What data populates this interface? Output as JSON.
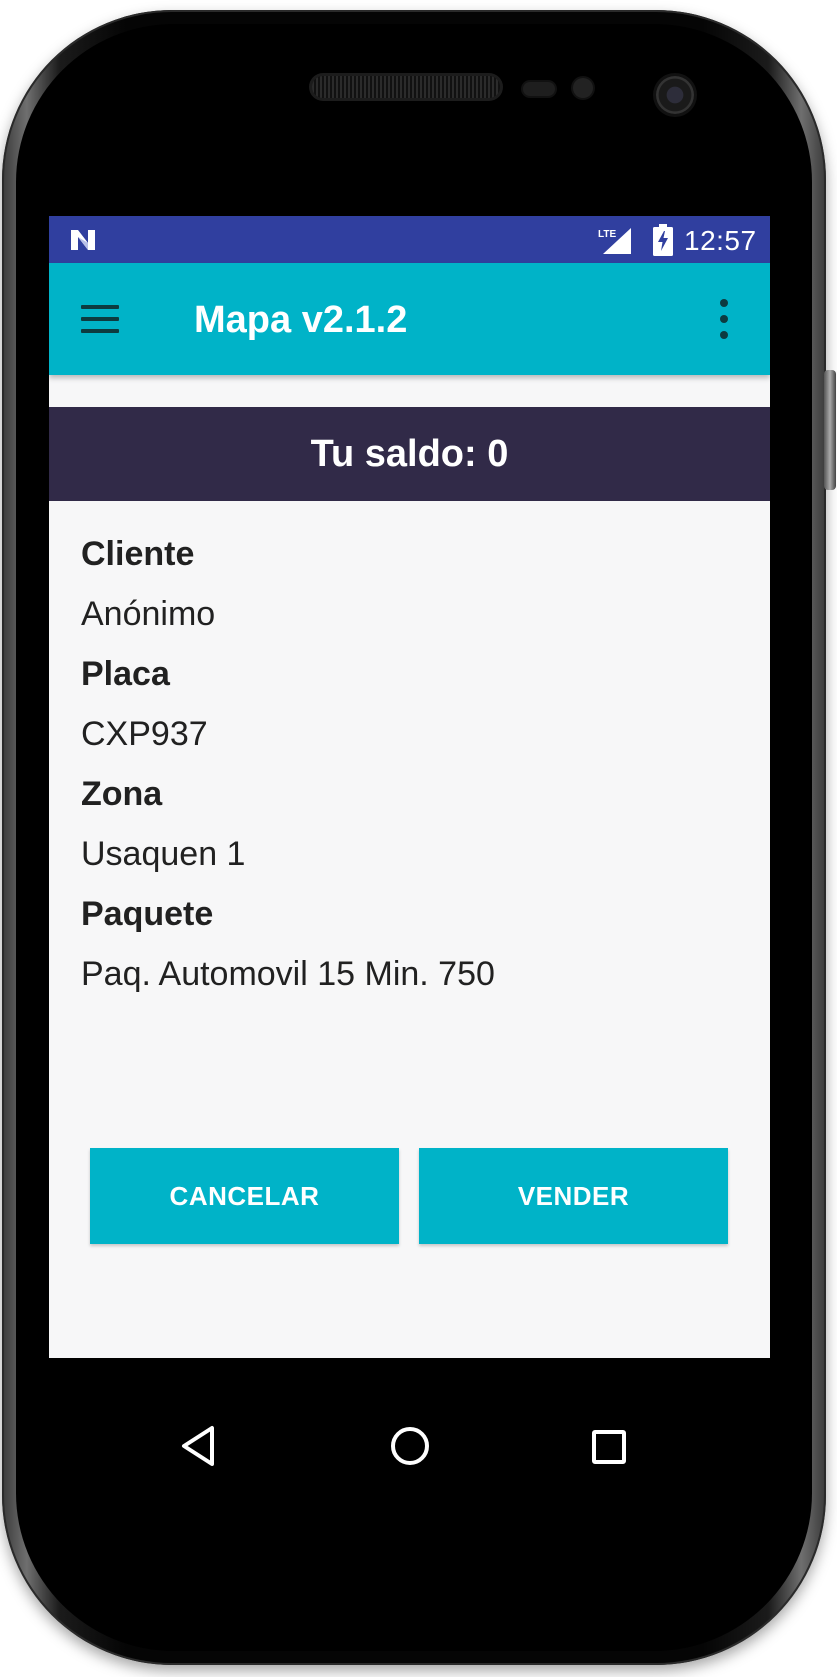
{
  "status_bar": {
    "time": "12:57",
    "network_icon": "lte-signal-icon",
    "battery_icon": "battery-charging-icon",
    "notification_icon": "n-logo-icon",
    "color": "#303f9f"
  },
  "app_bar": {
    "title": "Mapa v2.1.2",
    "menu_icon": "hamburger-menu-icon",
    "overflow_icon": "more-vertical-icon",
    "color": "#00b3c8"
  },
  "balance": {
    "text": "Tu saldo: 0",
    "color": "#312a48"
  },
  "details": [
    {
      "label": "Cliente",
      "value": "Anónimo"
    },
    {
      "label": "Placa",
      "value": "CXP937"
    },
    {
      "label": "Zona",
      "value": "Usaquen 1"
    },
    {
      "label": "Paquete",
      "value": "Paq. Automovil 15 Min. 750"
    }
  ],
  "actions": {
    "cancel_label": "CANCELAR",
    "sell_label": "VENDER"
  },
  "nav_bar": {
    "back_icon": "back-triangle-icon",
    "home_icon": "home-circle-icon",
    "recents_icon": "recents-square-icon"
  }
}
